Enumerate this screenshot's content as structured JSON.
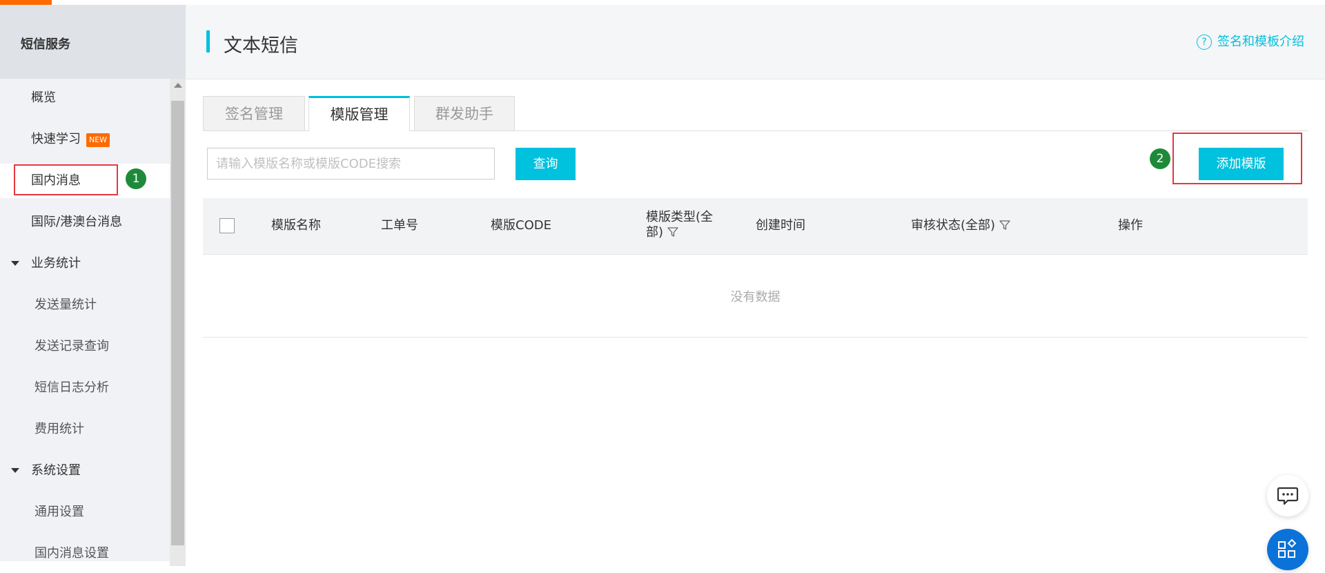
{
  "sidebar": {
    "title": "短信服务",
    "items": [
      {
        "label": "概览"
      },
      {
        "label": "快速学习",
        "badge": "NEW"
      },
      {
        "label": "国内消息",
        "step": "1"
      },
      {
        "label": "国际/港澳台消息"
      },
      {
        "label": "业务统计"
      },
      {
        "label": "发送量统计"
      },
      {
        "label": "发送记录查询"
      },
      {
        "label": "短信日志分析"
      },
      {
        "label": "费用统计"
      },
      {
        "label": "系统设置"
      },
      {
        "label": "通用设置"
      },
      {
        "label": "国内消息设置"
      }
    ]
  },
  "header": {
    "title": "文本短信",
    "help_link": "签名和模板介绍"
  },
  "tabs": [
    {
      "label": "签名管理"
    },
    {
      "label": "模版管理"
    },
    {
      "label": "群发助手"
    }
  ],
  "toolbar": {
    "search_placeholder": "请输入模版名称或模版CODE搜索",
    "query_label": "查询",
    "add_label": "添加模版",
    "step": "2"
  },
  "table": {
    "columns": {
      "name": "模版名称",
      "ticket": "工单号",
      "code": "模版CODE",
      "type": "模版类型(全部)",
      "created": "创建时间",
      "status": "审核状态(全部)",
      "actions": "操作"
    },
    "empty": "没有数据"
  },
  "colors": {
    "accent": "#00c1de",
    "brand": "#ff6a00",
    "highlight": "#e2373f",
    "step": "#1d8a3a"
  }
}
